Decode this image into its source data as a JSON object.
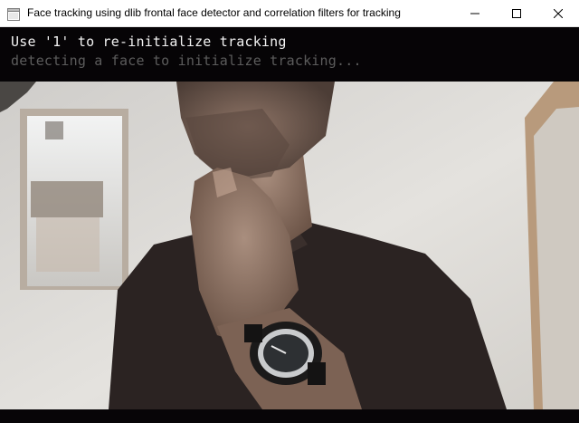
{
  "window": {
    "title": "Face tracking using dlib frontal face detector and correlation filters for tracking",
    "icons": {
      "app": "app-window-icon",
      "minimize": "minimize-icon",
      "maximize": "maximize-icon",
      "close": "close-icon"
    }
  },
  "overlay": {
    "instruction": "Use '1' to re-initialize tracking",
    "status": "detecting a face to initialize tracking..."
  },
  "colors": {
    "background": "#060406",
    "instruction_text": "#f2f2f2",
    "status_text": "#5c5c5c"
  }
}
